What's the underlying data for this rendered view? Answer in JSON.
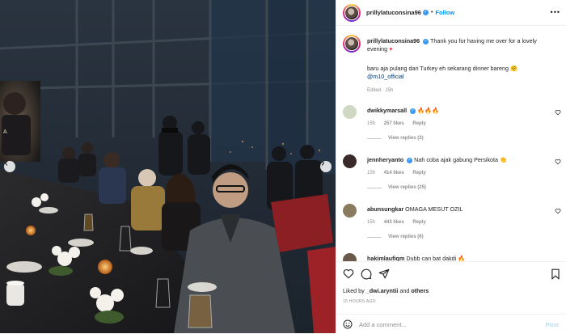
{
  "post": {
    "author": "prillylatuconsina96",
    "follow_label": "Follow",
    "more_label": "•••",
    "caption_line1": "Thank you for having me over for a lovely evening",
    "caption_line2": "baru aja pulang dari Turkey eh sekarang dinner bareng",
    "caption_mention": "@m10_official",
    "edited": "Edited · 15h"
  },
  "comments": [
    {
      "user": "dwikkymarsall",
      "text": "🔥🔥🔥",
      "time": "15h",
      "likes": "257 likes",
      "reply": "Reply",
      "view_replies": "View replies (2)",
      "avatar_color": "#cfd8c2"
    },
    {
      "user": "jennheryanto",
      "text": "Nah coba ajak gabung Persikota 👏",
      "time": "15h",
      "likes": "414 likes",
      "reply": "Reply",
      "view_replies": "View replies (25)",
      "avatar_color": "#3b2a2a"
    },
    {
      "user": "abunsungkar",
      "text": "OMAGA MESUT OZIL",
      "time": "15h",
      "likes": "443 likes",
      "reply": "Reply",
      "view_replies": "View replies (6)",
      "avatar_color": "#8a7a5e"
    },
    {
      "user": "hakimlaufiqm",
      "text": "Dubb can bat dakdi 🔥",
      "time": "",
      "likes": "",
      "reply": "",
      "view_replies": "",
      "avatar_color": "#6a5a4a"
    }
  ],
  "footer": {
    "liked_prefix": "Liked by",
    "liked_user": "_dwi.aryntii",
    "liked_and": "and",
    "liked_others": "others",
    "ago": "15 HOURS AGO",
    "add_placeholder": "Add a comment...",
    "post_label": "Post"
  },
  "colors": {
    "accent": "#0095f6",
    "verified": "#3897f0",
    "heart": "#ed4956"
  },
  "icons": [
    "heart-icon",
    "comment-icon",
    "share-icon",
    "save-icon",
    "emoji-icon",
    "more-icon",
    "verified-icon"
  ]
}
